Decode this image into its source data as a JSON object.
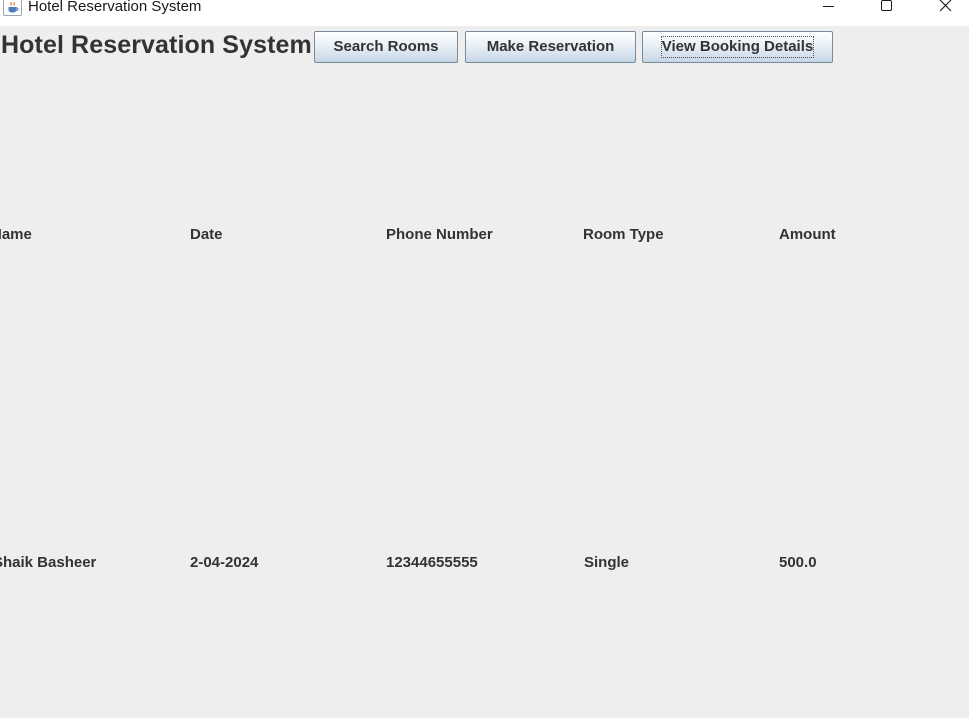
{
  "window": {
    "title": "Hotel Reservation System",
    "icon": "java-cup-icon",
    "controls": [
      "minimize-icon",
      "maximize-icon",
      "close-icon"
    ]
  },
  "header": {
    "heading": "Hotel Reservation System"
  },
  "toolbar": {
    "search_label": "Search Rooms",
    "reserve_label": "Make Reservation",
    "view_label": "View Booking Details"
  },
  "table": {
    "columns": [
      "Name",
      "Date",
      "Phone Number",
      "Room Type",
      "Amount"
    ],
    "rows": [
      [
        "Shaik Basheer",
        "2-04-2024",
        "12344655555",
        "Single",
        "500.0"
      ]
    ]
  },
  "colors": {
    "background": "#eeeeee",
    "text": "#333333",
    "button_border": "#7a8a99"
  }
}
